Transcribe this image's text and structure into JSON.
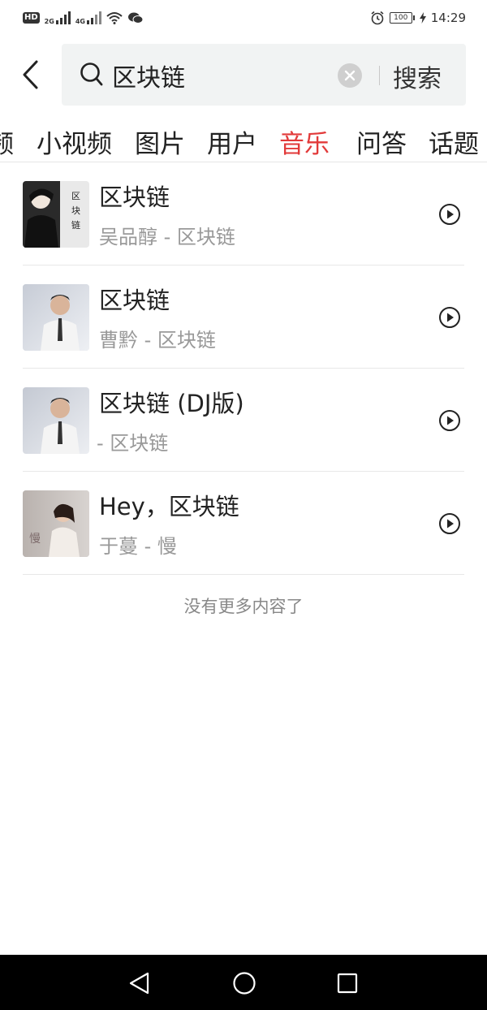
{
  "status_bar": {
    "hd": "HD",
    "net1": "2G",
    "net2": "4G",
    "battery": "100",
    "time": "14:29"
  },
  "search": {
    "query": "区块链",
    "button_label": "搜索"
  },
  "tabs": [
    {
      "label": "频"
    },
    {
      "label": "小视频"
    },
    {
      "label": "图片"
    },
    {
      "label": "用户"
    },
    {
      "label": "音乐"
    },
    {
      "label": "问答"
    },
    {
      "label": "话题"
    }
  ],
  "active_tab": "音乐",
  "music": [
    {
      "title": "区块链",
      "subtitle": "吴品醇 - 区块链",
      "cover_text": "区块链"
    },
    {
      "title": "区块链",
      "subtitle": "曹黔 - 区块链"
    },
    {
      "title": "区块链 (DJ版)",
      "subtitle": "- 区块链"
    },
    {
      "title": "Hey，区块链",
      "subtitle": "于蔓 - 慢",
      "cover_text": "慢"
    }
  ],
  "footer_text": "没有更多内容了",
  "colors": {
    "accent": "#e23a3a",
    "search_bg": "#f1f3f3",
    "secondary_text": "#999999"
  }
}
